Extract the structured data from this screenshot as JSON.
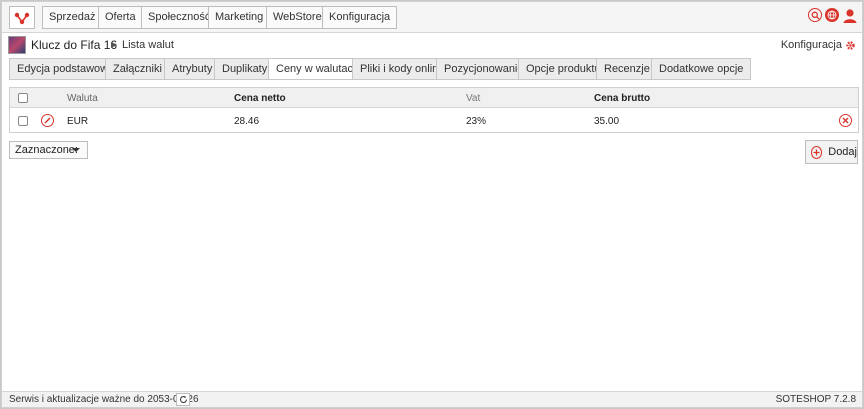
{
  "menu": [
    "Sprzedaż",
    "Oferta",
    "Społeczność",
    "Marketing",
    "WebStore",
    "Konfiguracja"
  ],
  "header": {
    "product_title": "Klucz do Fifa 16",
    "breadcrumb": "Lista walut",
    "config_link": "Konfiguracja"
  },
  "tabs": [
    "Edycja podstawowa",
    "Załączniki",
    "Atrybuty",
    "Duplikaty",
    "Ceny w walutach",
    "Pliki i kody online",
    "Pozycjonowanie",
    "Opcje produktu",
    "Recenzje",
    "Dodatkowe opcje"
  ],
  "active_tab": "Ceny w walutach",
  "table": {
    "headers": {
      "currency": "Waluta",
      "net_price": "Cena netto",
      "vat": "Vat",
      "gross_price": "Cena brutto"
    },
    "rows": [
      {
        "currency": "EUR",
        "net_price": "28.46",
        "vat": "23%",
        "gross_price": "35.00"
      }
    ]
  },
  "bulk_select": {
    "selected": "Zaznaczone:"
  },
  "add_button": "Dodaj",
  "footer": {
    "service_text": "Serwis i aktualizacje ważne do 2053-08-26",
    "version": "SOTESHOP 7.2.8"
  },
  "colors": {
    "accent": "#d9332b",
    "tab_bg": "#ececec",
    "header_bg": "#f0f0f0"
  },
  "icons": [
    "logo-icon",
    "search-icon",
    "globe-icon",
    "user-icon",
    "gear-icon",
    "edit-icon",
    "delete-icon",
    "add-icon",
    "refresh-icon",
    "caret-down-icon"
  ]
}
